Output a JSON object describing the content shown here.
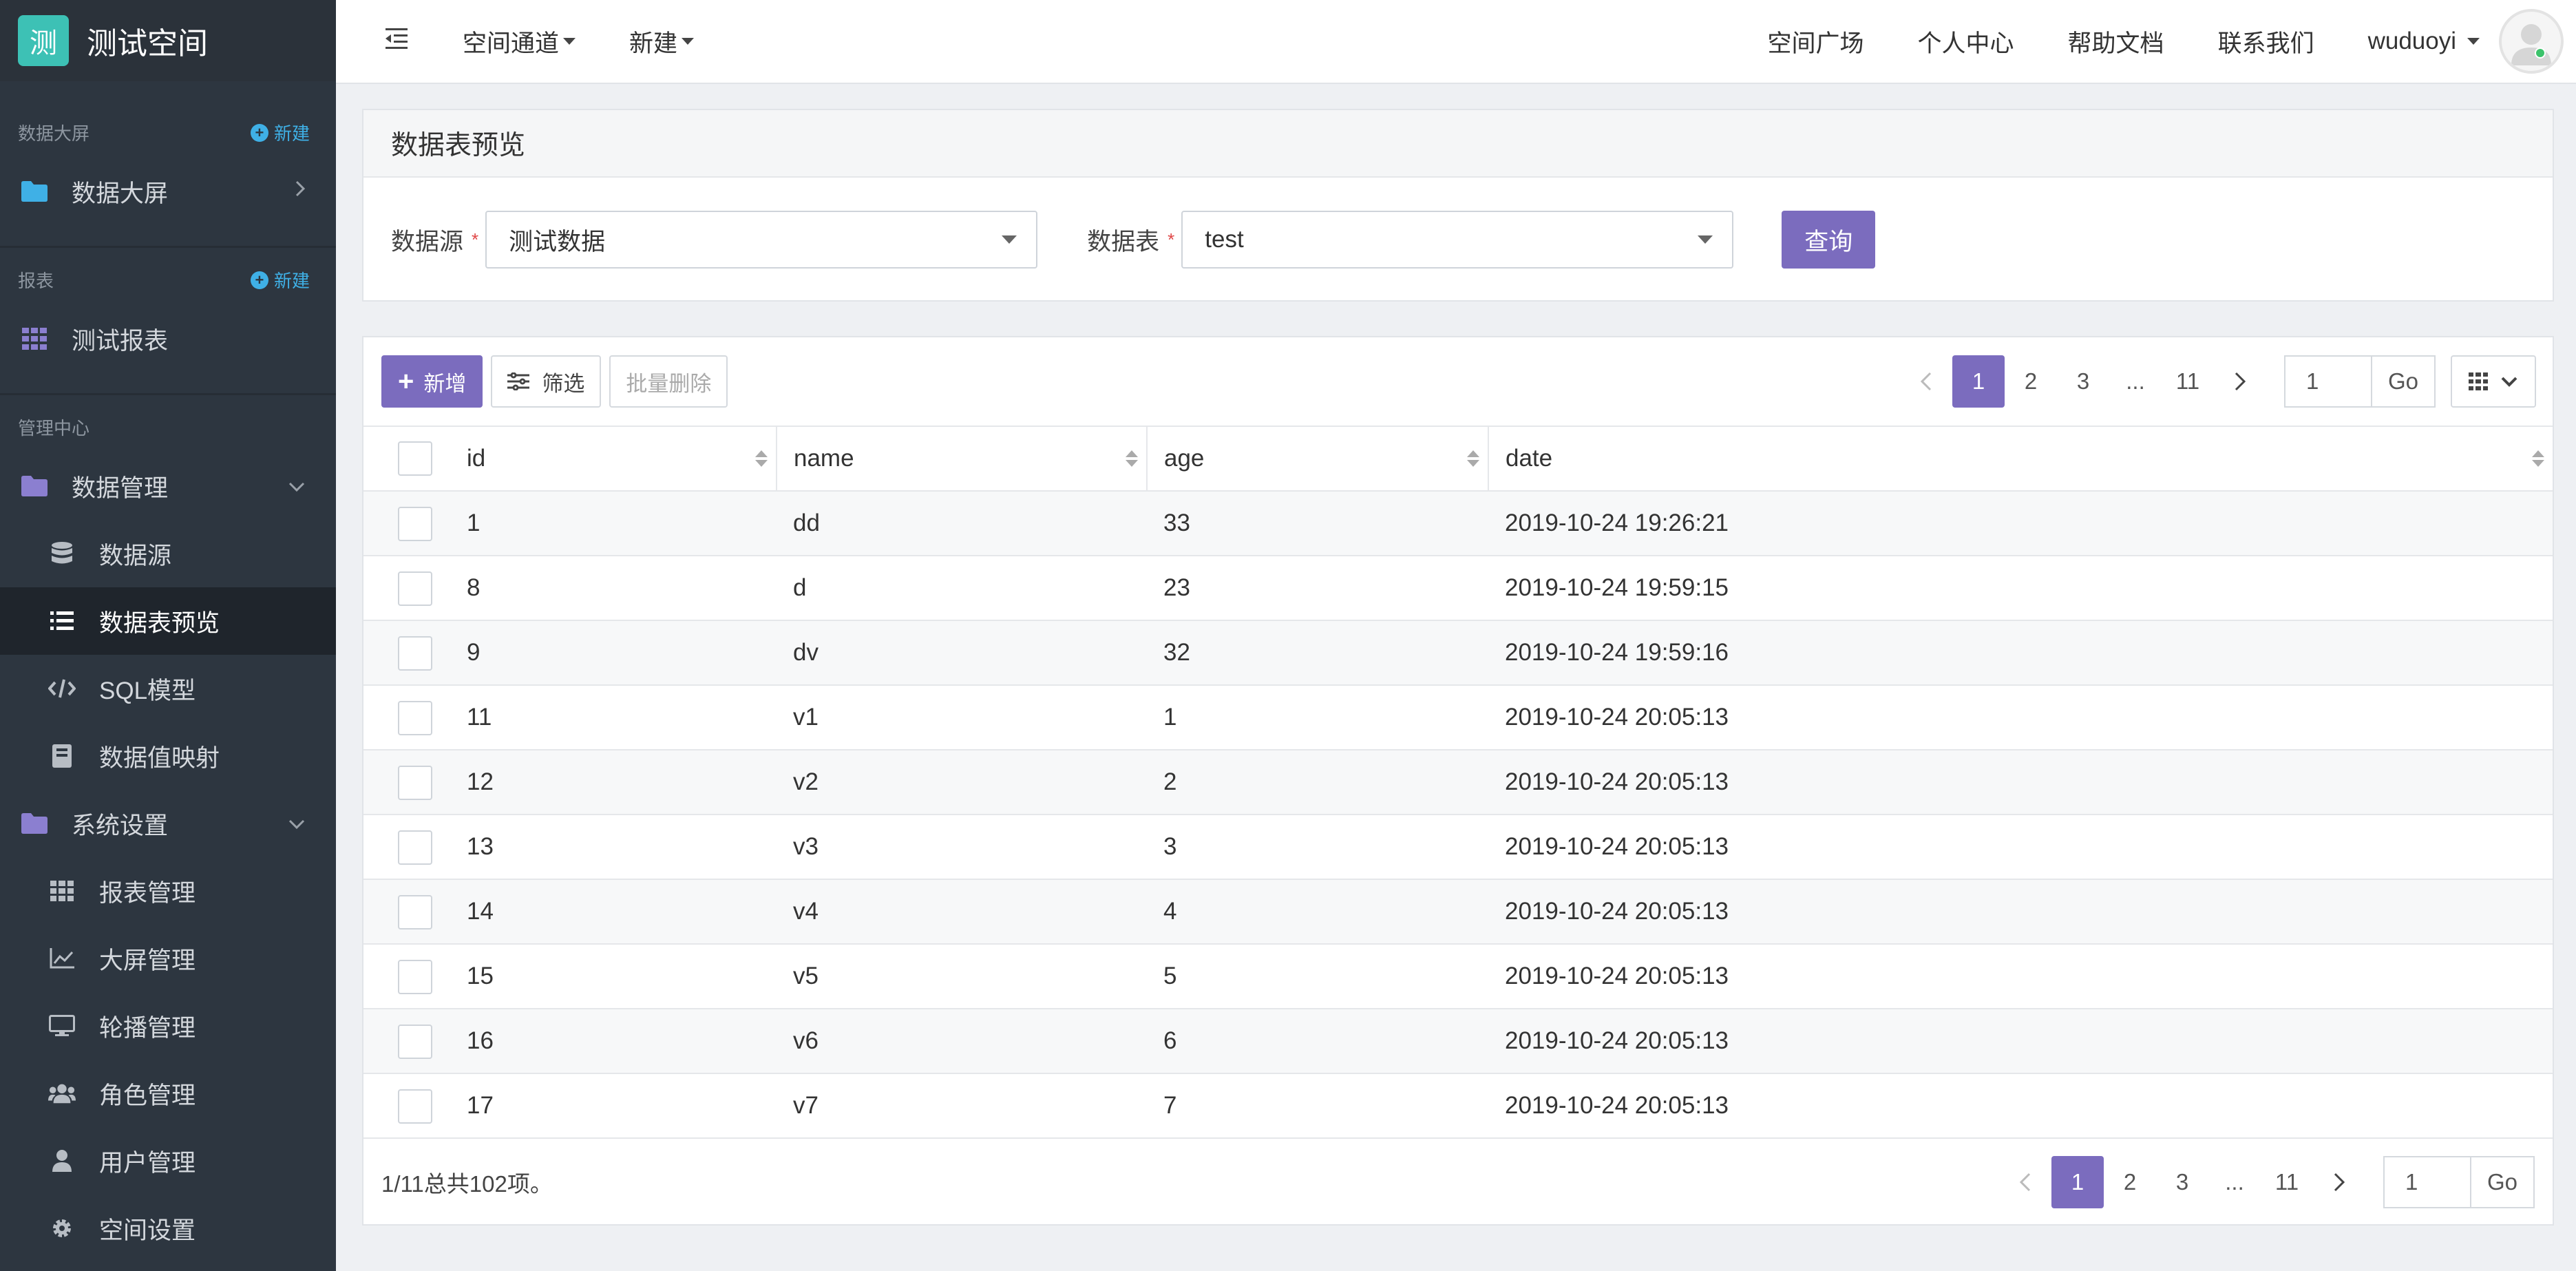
{
  "brand": {
    "logo_char": "测",
    "title": "测试空间"
  },
  "sidebar": {
    "sections": {
      "screen": {
        "label": "数据大屏",
        "new_label": "新建",
        "item": "数据大屏"
      },
      "report": {
        "label": "报表",
        "new_label": "新建",
        "item": "测试报表"
      },
      "admin": {
        "label": "管理中心",
        "data_mgmt": "数据管理",
        "data_items": [
          "数据源",
          "数据表预览",
          "SQL模型",
          "数据值映射"
        ],
        "sys_settings": "系统设置",
        "sys_items": [
          "报表管理",
          "大屏管理",
          "轮播管理",
          "角色管理",
          "用户管理",
          "空间设置"
        ]
      }
    }
  },
  "topbar": {
    "menu1": "空间通道",
    "menu2": "新建",
    "links": [
      "空间广场",
      "个人中心",
      "帮助文档",
      "联系我们"
    ],
    "username": "wuduoyi"
  },
  "query": {
    "title": "数据表预览",
    "source_label": "数据源",
    "source_value": "测试数据",
    "table_label": "数据表",
    "table_value": "test",
    "query_button": "查询"
  },
  "toolbar": {
    "add": "新增",
    "filter": "筛选",
    "batch_delete": "批量删除"
  },
  "pagination": {
    "pages": [
      "1",
      "2",
      "3",
      "...",
      "11"
    ],
    "current": "1",
    "goto_value": "1",
    "go_label": "Go"
  },
  "table": {
    "columns": [
      "id",
      "name",
      "age",
      "date"
    ],
    "rows": [
      [
        "1",
        "dd",
        "33",
        "2019-10-24 19:26:21"
      ],
      [
        "8",
        "d",
        "23",
        "2019-10-24 19:59:15"
      ],
      [
        "9",
        "dv",
        "32",
        "2019-10-24 19:59:16"
      ],
      [
        "11",
        "v1",
        "1",
        "2019-10-24 20:05:13"
      ],
      [
        "12",
        "v2",
        "2",
        "2019-10-24 20:05:13"
      ],
      [
        "13",
        "v3",
        "3",
        "2019-10-24 20:05:13"
      ],
      [
        "14",
        "v4",
        "4",
        "2019-10-24 20:05:13"
      ],
      [
        "15",
        "v5",
        "5",
        "2019-10-24 20:05:13"
      ],
      [
        "16",
        "v6",
        "6",
        "2019-10-24 20:05:13"
      ],
      [
        "17",
        "v7",
        "7",
        "2019-10-24 20:05:13"
      ]
    ]
  },
  "footer": {
    "summary": "1/11总共102项。"
  },
  "colors": {
    "accent": "#7b6cbe",
    "sidebar_bg": "#2d3640",
    "brand_logo": "#3dc1b5",
    "link_blue": "#3fb0e6"
  }
}
